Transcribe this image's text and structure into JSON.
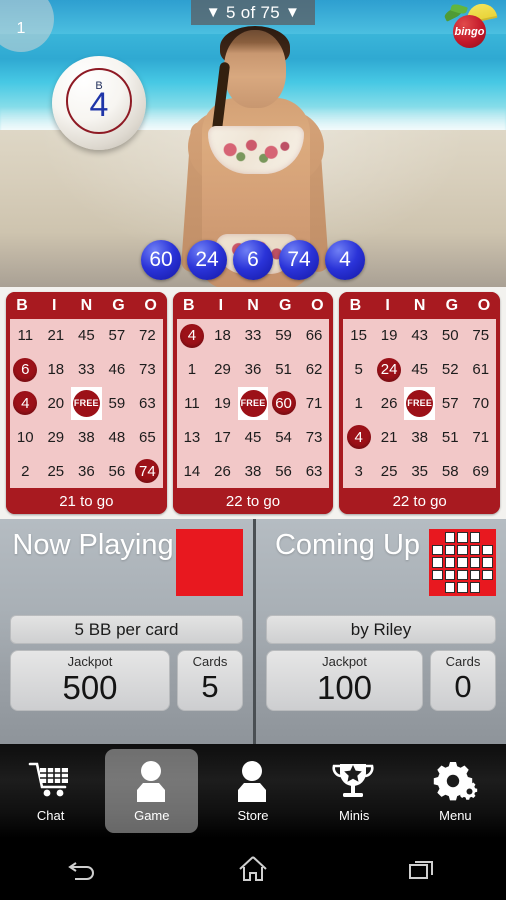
{
  "header": {
    "badge_count": "1",
    "counter_text": "5 of 75",
    "tri_left": "▼",
    "tri_right": "▼",
    "logo_text": "bingo"
  },
  "ball": {
    "letter": "B",
    "number": "4"
  },
  "called_balls": [
    "60",
    "24",
    "6",
    "74",
    "4"
  ],
  "cards": [
    {
      "headers": [
        "B",
        "I",
        "N",
        "G",
        "O"
      ],
      "rows": [
        [
          {
            "v": "11",
            "m": false
          },
          {
            "v": "21",
            "m": false
          },
          {
            "v": "45",
            "m": false
          },
          {
            "v": "57",
            "m": false
          },
          {
            "v": "72",
            "m": false
          }
        ],
        [
          {
            "v": "6",
            "m": true
          },
          {
            "v": "18",
            "m": false
          },
          {
            "v": "33",
            "m": false
          },
          {
            "v": "46",
            "m": false
          },
          {
            "v": "73",
            "m": false
          }
        ],
        [
          {
            "v": "4",
            "m": true
          },
          {
            "v": "20",
            "m": false
          },
          {
            "v": "FREE",
            "m": false,
            "free": true
          },
          {
            "v": "59",
            "m": false
          },
          {
            "v": "63",
            "m": false
          }
        ],
        [
          {
            "v": "10",
            "m": false
          },
          {
            "v": "29",
            "m": false
          },
          {
            "v": "38",
            "m": false
          },
          {
            "v": "48",
            "m": false
          },
          {
            "v": "65",
            "m": false
          }
        ],
        [
          {
            "v": "2",
            "m": false
          },
          {
            "v": "25",
            "m": false
          },
          {
            "v": "36",
            "m": false
          },
          {
            "v": "56",
            "m": false
          },
          {
            "v": "74",
            "m": true
          }
        ]
      ],
      "footer": "21 to go"
    },
    {
      "headers": [
        "B",
        "I",
        "N",
        "G",
        "O"
      ],
      "rows": [
        [
          {
            "v": "4",
            "m": true
          },
          {
            "v": "18",
            "m": false
          },
          {
            "v": "33",
            "m": false
          },
          {
            "v": "59",
            "m": false
          },
          {
            "v": "66",
            "m": false
          }
        ],
        [
          {
            "v": "1",
            "m": false
          },
          {
            "v": "29",
            "m": false
          },
          {
            "v": "36",
            "m": false
          },
          {
            "v": "51",
            "m": false
          },
          {
            "v": "62",
            "m": false
          }
        ],
        [
          {
            "v": "11",
            "m": false
          },
          {
            "v": "19",
            "m": false
          },
          {
            "v": "FREE",
            "m": false,
            "free": true
          },
          {
            "v": "60",
            "m": true
          },
          {
            "v": "71",
            "m": false
          }
        ],
        [
          {
            "v": "13",
            "m": false
          },
          {
            "v": "17",
            "m": false
          },
          {
            "v": "45",
            "m": false
          },
          {
            "v": "54",
            "m": false
          },
          {
            "v": "73",
            "m": false
          }
        ],
        [
          {
            "v": "14",
            "m": false
          },
          {
            "v": "26",
            "m": false
          },
          {
            "v": "38",
            "m": false
          },
          {
            "v": "56",
            "m": false
          },
          {
            "v": "63",
            "m": false
          }
        ]
      ],
      "footer": "22 to go"
    },
    {
      "headers": [
        "B",
        "I",
        "N",
        "G",
        "O"
      ],
      "rows": [
        [
          {
            "v": "15",
            "m": false
          },
          {
            "v": "19",
            "m": false
          },
          {
            "v": "43",
            "m": false
          },
          {
            "v": "50",
            "m": false
          },
          {
            "v": "75",
            "m": false
          }
        ],
        [
          {
            "v": "5",
            "m": false
          },
          {
            "v": "24",
            "m": true
          },
          {
            "v": "45",
            "m": false
          },
          {
            "v": "52",
            "m": false
          },
          {
            "v": "61",
            "m": false
          }
        ],
        [
          {
            "v": "1",
            "m": false
          },
          {
            "v": "26",
            "m": false
          },
          {
            "v": "FREE",
            "m": false,
            "free": true
          },
          {
            "v": "57",
            "m": false
          },
          {
            "v": "70",
            "m": false
          }
        ],
        [
          {
            "v": "4",
            "m": true
          },
          {
            "v": "21",
            "m": false
          },
          {
            "v": "38",
            "m": false
          },
          {
            "v": "51",
            "m": false
          },
          {
            "v": "71",
            "m": false
          }
        ],
        [
          {
            "v": "3",
            "m": false
          },
          {
            "v": "25",
            "m": false
          },
          {
            "v": "35",
            "m": false
          },
          {
            "v": "58",
            "m": false
          },
          {
            "v": "69",
            "m": false
          }
        ]
      ],
      "footer": "22 to go"
    }
  ],
  "now_playing": {
    "title": "Now Playing",
    "pattern": [
      [
        1,
        1,
        1,
        1,
        1
      ],
      [
        1,
        1,
        1,
        1,
        1
      ],
      [
        1,
        1,
        1,
        1,
        1
      ],
      [
        1,
        1,
        1,
        1,
        1
      ],
      [
        1,
        1,
        1,
        1,
        1
      ]
    ],
    "cost_label": "5 BB per card",
    "jackpot_label": "Jackpot",
    "jackpot_value": "500",
    "cards_label": "Cards",
    "cards_value": "5"
  },
  "coming_up": {
    "title": "Coming Up",
    "pattern": [
      [
        1,
        0,
        0,
        0,
        1
      ],
      [
        0,
        0,
        0,
        0,
        0
      ],
      [
        0,
        0,
        0,
        0,
        0
      ],
      [
        0,
        0,
        0,
        0,
        0
      ],
      [
        1,
        0,
        0,
        0,
        1
      ]
    ],
    "host_label": "by Riley",
    "jackpot_label": "Jackpot",
    "jackpot_value": "100",
    "cards_label": "Cards",
    "cards_value": "0"
  },
  "app_nav": [
    {
      "label": "Chat",
      "icon": "shopping-cart-icon",
      "active": false
    },
    {
      "label": "Game",
      "icon": "person-icon",
      "active": true
    },
    {
      "label": "Store",
      "icon": "person-icon",
      "active": false
    },
    {
      "label": "Minis",
      "icon": "trophy-icon",
      "active": false
    },
    {
      "label": "Menu",
      "icon": "gear-icon",
      "active": false
    }
  ],
  "system_nav": [
    {
      "name": "back-button",
      "icon": "back-arrow-icon"
    },
    {
      "name": "home-button",
      "icon": "home-icon"
    },
    {
      "name": "recents-button",
      "icon": "recents-icon"
    }
  ],
  "colors": {
    "card_red": "#a81a20",
    "daub_red": "#9c1118",
    "card_body": "#f2c8c8",
    "ball_blue": "#2a33d8",
    "pattern_red": "#e8181f"
  }
}
